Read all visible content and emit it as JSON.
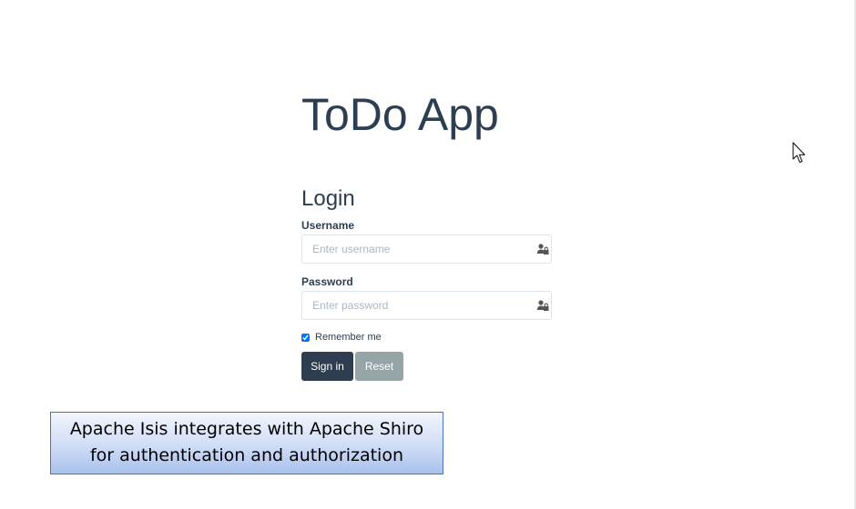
{
  "app": {
    "title": "ToDo App"
  },
  "login": {
    "heading": "Login",
    "username": {
      "label": "Username",
      "placeholder": "Enter username",
      "value": "",
      "icon": "user-icon"
    },
    "password": {
      "label": "Password",
      "placeholder": "Enter password",
      "value": "",
      "icon": "lock-icon"
    },
    "remember_me": {
      "label": "Remember me",
      "checked": true
    },
    "signin_label": "Sign in",
    "reset_label": "Reset"
  },
  "callout": {
    "line1": "Apache Isis integrates with Apache Shiro",
    "line2": "for authentication and authorization"
  },
  "colors": {
    "primary": "#2c3e50",
    "reset_button": "#95a5a6",
    "input_border": "#dce4ec",
    "placeholder": "#acb6c0",
    "callout_border": "#4a74b5"
  }
}
